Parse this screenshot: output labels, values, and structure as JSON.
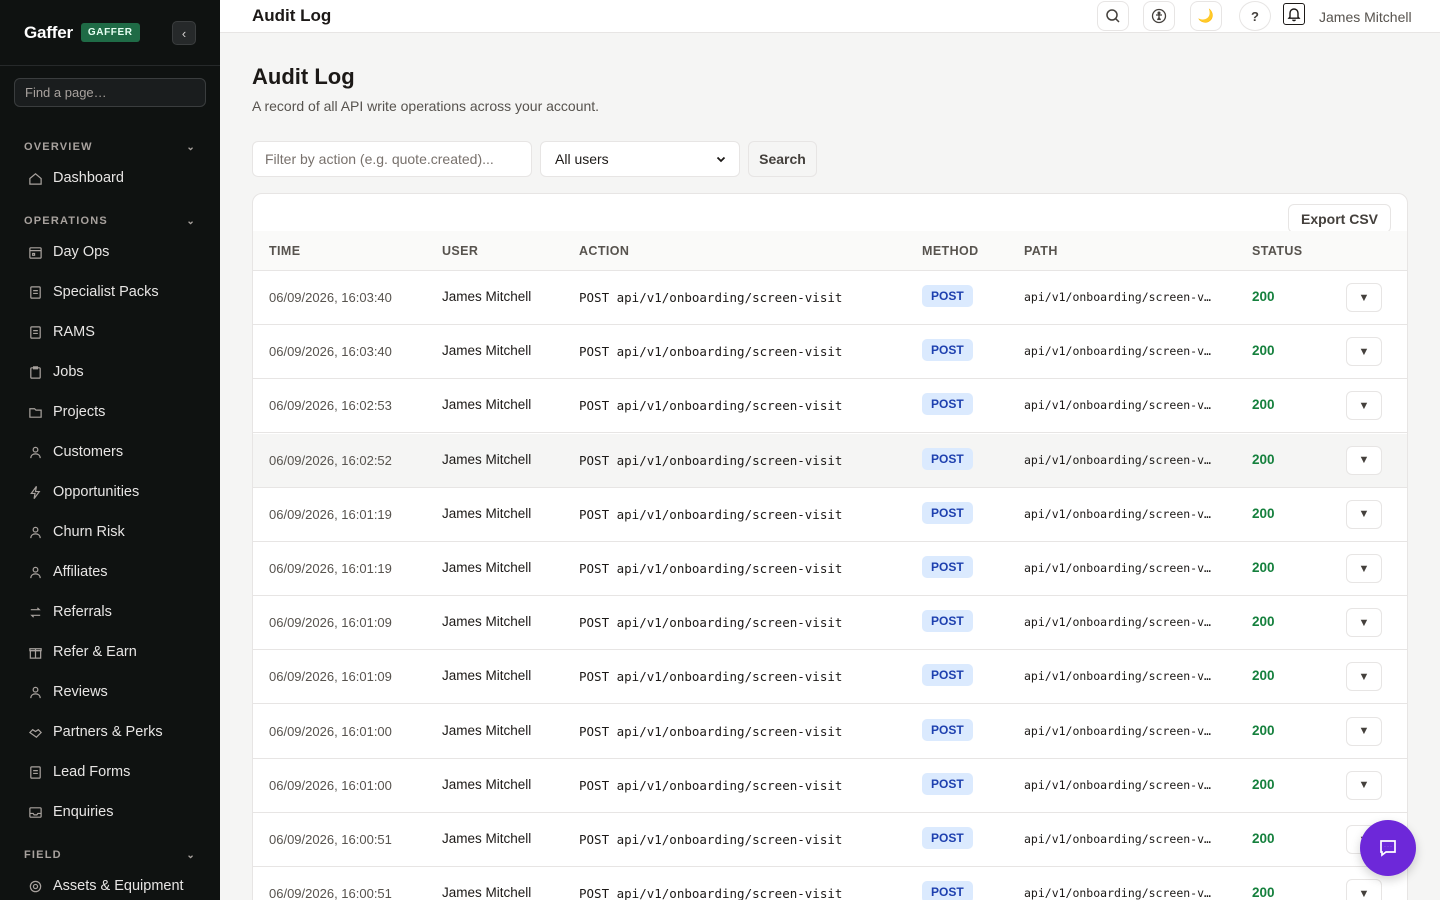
{
  "brand": {
    "name": "Gaffer",
    "badge": "GAFFER"
  },
  "sidebar": {
    "collapse_glyph": "‹",
    "search_placeholder": "Find a page…",
    "sections": [
      {
        "title": "OVERVIEW",
        "items": [
          {
            "label": "Dashboard",
            "icon": "home-icon"
          }
        ]
      },
      {
        "title": "OPERATIONS",
        "items": [
          {
            "label": "Day Ops",
            "icon": "calendar-icon"
          },
          {
            "label": "Specialist Packs",
            "icon": "document-icon"
          },
          {
            "label": "RAMS",
            "icon": "document-icon"
          },
          {
            "label": "Jobs",
            "icon": "clipboard-icon"
          },
          {
            "label": "Projects",
            "icon": "folder-icon"
          },
          {
            "label": "Customers",
            "icon": "users-icon"
          },
          {
            "label": "Opportunities",
            "icon": "bolt-icon"
          },
          {
            "label": "Churn Risk",
            "icon": "users-icon"
          },
          {
            "label": "Affiliates",
            "icon": "users-icon"
          },
          {
            "label": "Referrals",
            "icon": "arrows-icon"
          },
          {
            "label": "Refer & Earn",
            "icon": "gift-icon"
          },
          {
            "label": "Reviews",
            "icon": "users-icon"
          },
          {
            "label": "Partners & Perks",
            "icon": "handshake-icon"
          },
          {
            "label": "Lead Forms",
            "icon": "document-icon"
          },
          {
            "label": "Enquiries",
            "icon": "inbox-icon"
          }
        ]
      },
      {
        "title": "FIELD",
        "items": [
          {
            "label": "Assets & Equipment",
            "icon": "gear-icon"
          }
        ]
      }
    ]
  },
  "topbar": {
    "title": "Audit Log",
    "user_name": "James Mitchell",
    "help_glyph": "?",
    "theme_glyph": "🌙"
  },
  "page": {
    "title": "Audit Log",
    "subtitle": "A record of all API write operations across your account.",
    "filter_placeholder": "Filter by action (e.g. quote.created)...",
    "user_filter_value": "All users",
    "search_label": "Search",
    "export_label": "Export CSV"
  },
  "table": {
    "columns": [
      "TIME",
      "USER",
      "ACTION",
      "METHOD",
      "PATH",
      "STATUS"
    ],
    "expand_glyph": "▼",
    "rows": [
      {
        "time": "06/09/2026, 16:03:40",
        "user": "James Mitchell",
        "action": "POST api/v1/onboarding/screen-visit",
        "method": "POST",
        "path": "api/v1/onboarding/screen-v…",
        "status": "200"
      },
      {
        "time": "06/09/2026, 16:03:40",
        "user": "James Mitchell",
        "action": "POST api/v1/onboarding/screen-visit",
        "method": "POST",
        "path": "api/v1/onboarding/screen-v…",
        "status": "200"
      },
      {
        "time": "06/09/2026, 16:02:53",
        "user": "James Mitchell",
        "action": "POST api/v1/onboarding/screen-visit",
        "method": "POST",
        "path": "api/v1/onboarding/screen-v…",
        "status": "200"
      },
      {
        "time": "06/09/2026, 16:02:52",
        "user": "James Mitchell",
        "action": "POST api/v1/onboarding/screen-visit",
        "method": "POST",
        "path": "api/v1/onboarding/screen-v…",
        "status": "200"
      },
      {
        "time": "06/09/2026, 16:01:19",
        "user": "James Mitchell",
        "action": "POST api/v1/onboarding/screen-visit",
        "method": "POST",
        "path": "api/v1/onboarding/screen-v…",
        "status": "200"
      },
      {
        "time": "06/09/2026, 16:01:19",
        "user": "James Mitchell",
        "action": "POST api/v1/onboarding/screen-visit",
        "method": "POST",
        "path": "api/v1/onboarding/screen-v…",
        "status": "200"
      },
      {
        "time": "06/09/2026, 16:01:09",
        "user": "James Mitchell",
        "action": "POST api/v1/onboarding/screen-visit",
        "method": "POST",
        "path": "api/v1/onboarding/screen-v…",
        "status": "200"
      },
      {
        "time": "06/09/2026, 16:01:09",
        "user": "James Mitchell",
        "action": "POST api/v1/onboarding/screen-visit",
        "method": "POST",
        "path": "api/v1/onboarding/screen-v…",
        "status": "200"
      },
      {
        "time": "06/09/2026, 16:01:00",
        "user": "James Mitchell",
        "action": "POST api/v1/onboarding/screen-visit",
        "method": "POST",
        "path": "api/v1/onboarding/screen-v…",
        "status": "200"
      },
      {
        "time": "06/09/2026, 16:01:00",
        "user": "James Mitchell",
        "action": "POST api/v1/onboarding/screen-visit",
        "method": "POST",
        "path": "api/v1/onboarding/screen-v…",
        "status": "200"
      },
      {
        "time": "06/09/2026, 16:00:51",
        "user": "James Mitchell",
        "action": "POST api/v1/onboarding/screen-visit",
        "method": "POST",
        "path": "api/v1/onboarding/screen-v…",
        "status": "200"
      },
      {
        "time": "06/09/2026, 16:00:51",
        "user": "James Mitchell",
        "action": "POST api/v1/onboarding/screen-visit",
        "method": "POST",
        "path": "api/v1/onboarding/screen-v…",
        "status": "200"
      }
    ]
  },
  "colors": {
    "sidebar_bg": "#0f1211",
    "brand_badge": "#1f6b46",
    "method_badge_bg": "#dbeafe",
    "status_ok": "#15803d",
    "fab": "#6d28d9"
  }
}
